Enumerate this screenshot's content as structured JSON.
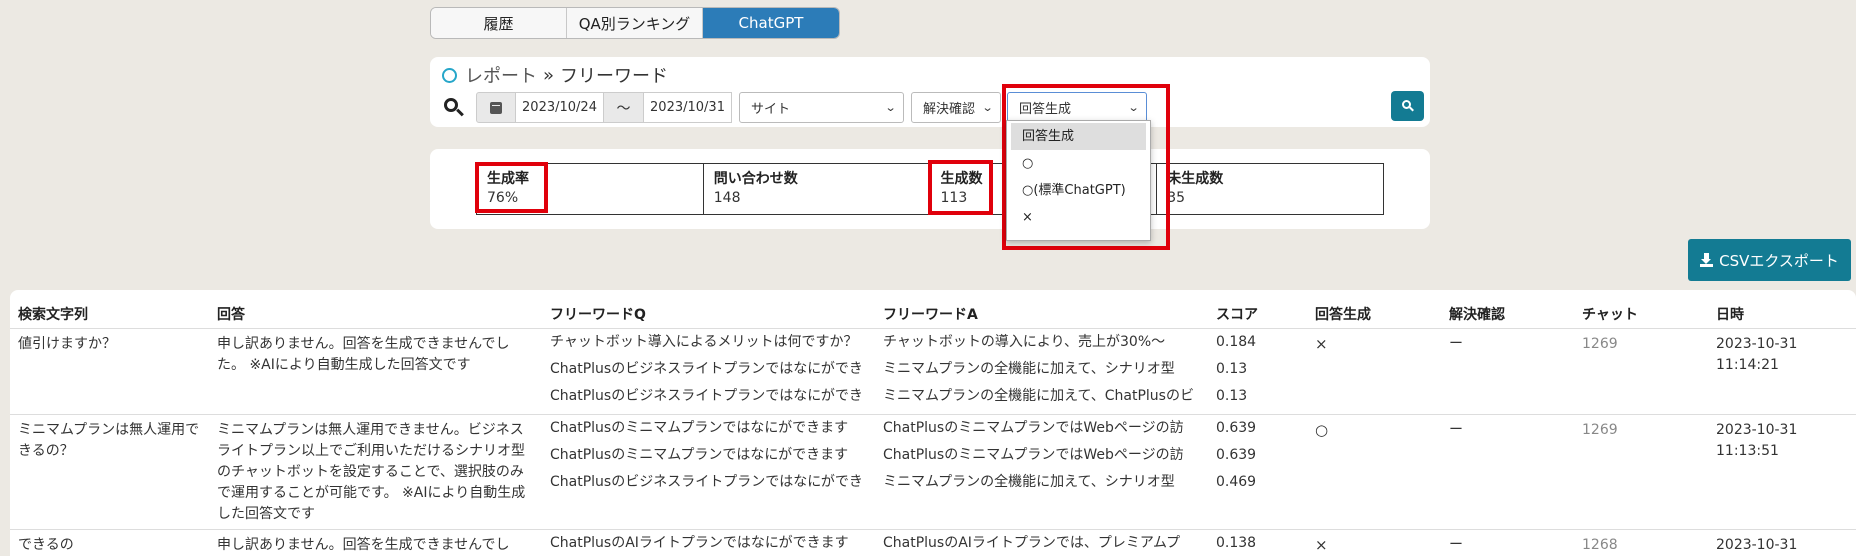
{
  "tabs": [
    {
      "label": "履歴",
      "active": false
    },
    {
      "label": "QA別ランキング",
      "active": false
    },
    {
      "label": "ChatGPT",
      "active": true
    }
  ],
  "breadcrumb": {
    "parent": "レポート",
    "separator": "»",
    "current": "フリーワード"
  },
  "search": {
    "date_from": "2023/10/24",
    "date_separator": "～",
    "date_to": "2023/10/31",
    "site_select": "サイト",
    "resolve_select": "解決確認",
    "answer_select": "回答生成"
  },
  "dropdown": {
    "options": [
      "回答生成",
      "○",
      "○(標準ChatGPT)",
      "×"
    ],
    "selected": "回答生成"
  },
  "stats": [
    {
      "key": "生成率",
      "value": "76%"
    },
    {
      "key": "問い合わせ数",
      "value": "148"
    },
    {
      "key": "生成数",
      "value": "113"
    },
    {
      "key": "未生成数",
      "value": "35"
    }
  ],
  "export_label": "CSVエクスポート",
  "table": {
    "headers": [
      "検索文字列",
      "回答",
      "フリーワードQ",
      "フリーワードA",
      "スコア",
      "回答生成",
      "解決確認",
      "チャット",
      "日時"
    ],
    "rows": [
      {
        "query": "値引けますか？",
        "answer": "申し訳ありません。回答を生成できませんでした。 ※AIにより自動生成した回答文です",
        "q": [
          "チャットボット導入によるメリットは何ですか？",
          "ChatPlusのビジネスライトプランではなにができ",
          "ChatPlusのビジネスライトプランではなにができ"
        ],
        "a": [
          "チャットボットの導入により、売上が30%～",
          "ミニマムプランの全機能に加えて、シナリオ型",
          "ミニマムプランの全機能に加えて、ChatPlusのビ"
        ],
        "scores": [
          "0.184",
          "0.13",
          "0.13"
        ],
        "generated": "×",
        "resolved": "ー",
        "chat": "1269",
        "date": "2023-10-31",
        "time": "11:14:21"
      },
      {
        "query": "ミニマムプランは無人運用できるの？",
        "answer": "ミニマムプランは無人運用できません。ビジネスライトプラン以上でご利用いただけるシナリオ型のチャットボットを設定することで、選択肢のみで運用することが可能です。 ※AIにより自動生成した回答文です",
        "q": [
          "ChatPlusのミニマムプランではなにができます",
          "ChatPlusのミニマムプランではなにができます",
          "ChatPlusのビジネスライトプランではなにができ"
        ],
        "a": [
          "ChatPlusのミニマムプランではWebページの訪",
          "ChatPlusのミニマムプランではWebページの訪",
          "ミニマムプランの全機能に加えて、シナリオ型"
        ],
        "scores": [
          "0.639",
          "0.639",
          "0.469"
        ],
        "generated": "○",
        "resolved": "ー",
        "chat": "1269",
        "date": "2023-10-31",
        "time": "11:13:51"
      },
      {
        "query": "できるの",
        "answer": "申し訳ありません。回答を生成できませんでし",
        "q": [
          "ChatPlusのAIライトプランではなにができます"
        ],
        "a": [
          "ChatPlusのAIライトプランでは、プレミアムプ"
        ],
        "scores": [
          "0.138"
        ],
        "generated": "×",
        "resolved": "ー",
        "chat": "1268",
        "date": "2023-10-31",
        "time": ""
      }
    ]
  }
}
